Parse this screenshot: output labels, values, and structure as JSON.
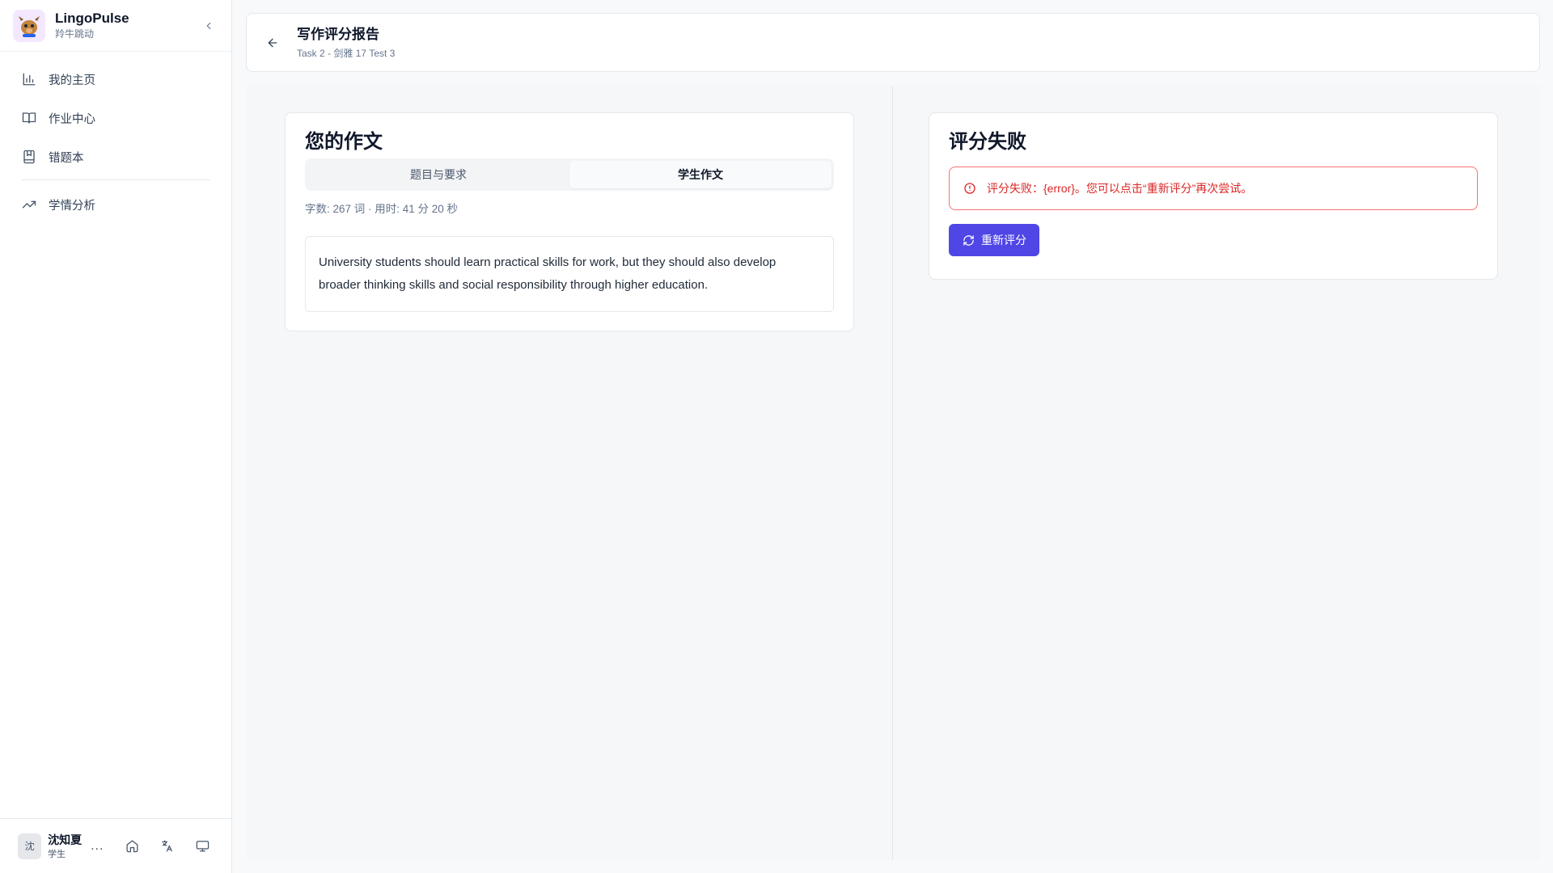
{
  "app": {
    "name": "LingoPulse",
    "subtitle": "羚牛跳动"
  },
  "sidebar": {
    "items": [
      {
        "label": "我的主页",
        "icon": "bar-chart-icon"
      },
      {
        "label": "作业中心",
        "icon": "book-open-icon"
      },
      {
        "label": "错题本",
        "icon": "notebook-icon"
      },
      {
        "label": "学情分析",
        "icon": "trending-up-icon"
      }
    ],
    "user": {
      "avatar_text": "沈",
      "name": "沈知夏",
      "role": "学生",
      "more": "..."
    }
  },
  "header": {
    "title": "写作评分报告",
    "subtitle": "Task 2 - 剑雅 17 Test 3"
  },
  "essay_card": {
    "title": "您的作文",
    "tabs": [
      "题目与要求",
      "学生作文"
    ],
    "active_tab": "学生作文",
    "meta": "字数: 267 词 · 用时: 41 分 20 秒",
    "essay_text": "University students should learn practical skills for work, but they should also develop broader thinking skills and social responsibility through higher education."
  },
  "result_card": {
    "title": "评分失败",
    "error_message": "评分失败：{error}。您可以点击“重新评分”再次尝试。",
    "retry_label": "重新评分"
  },
  "colors": {
    "accent": "#4f46e5",
    "error": "#dc2626",
    "error_border": "#f87171"
  }
}
